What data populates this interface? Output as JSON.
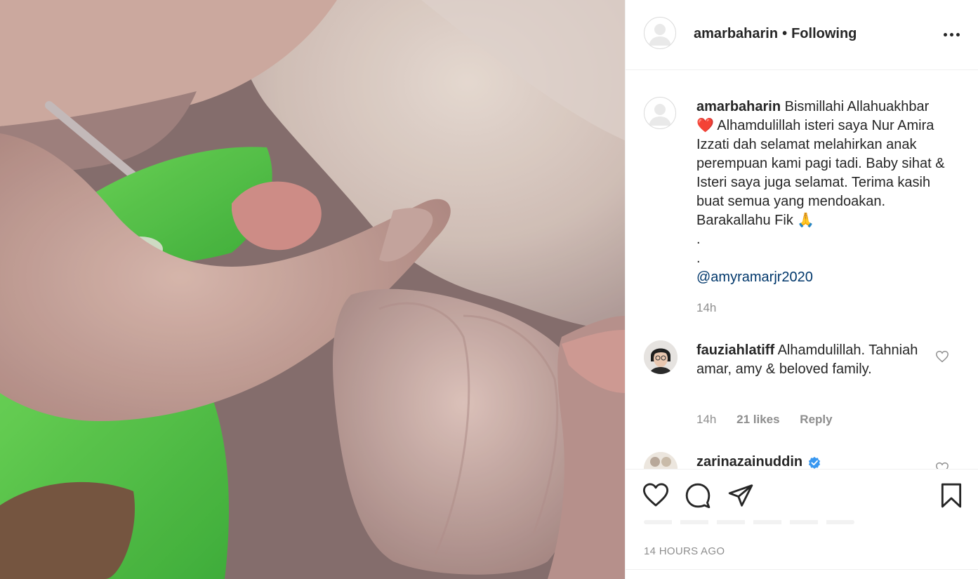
{
  "post": {
    "username": "amarbaharin",
    "separator": "•",
    "follow_status": "Following",
    "more_icon": "more-options-icon"
  },
  "caption": {
    "username": "amarbaharin",
    "line1": "Bismillahi Allahuakhbar",
    "heart_emoji": "❤️",
    "body": " Alhamdulillah isteri saya Nur Amira Izzati dah selamat melahirkan anak perempuan kami pagi tadi. Baby sihat & Isteri saya juga selamat. Terima kasih buat semua yang mendoakan. Barakallahu Fik ",
    "pray_emoji": "🙏",
    "dot1": ".",
    "dot2": ".",
    "mention": "@amyramarjr2020",
    "time": "14h"
  },
  "comments": [
    {
      "username": "fauziahlatiff",
      "text": "Alhamdulillah. Tahniah amar, amy & beloved family.",
      "time": "14h",
      "likes": "21 likes",
      "reply": "Reply"
    },
    {
      "username": "zarinazainuddin",
      "verified": true
    }
  ],
  "actions": {
    "like_icon": "heart-icon",
    "comment_icon": "comment-icon",
    "share_icon": "paper-plane-icon",
    "save_icon": "bookmark-icon"
  },
  "timestamp": "14 HOURS AGO",
  "colors": {
    "text": "#262626",
    "muted": "#8e8e8e",
    "mention": "#00376b",
    "border": "#efefef",
    "verified": "#3897f0"
  }
}
